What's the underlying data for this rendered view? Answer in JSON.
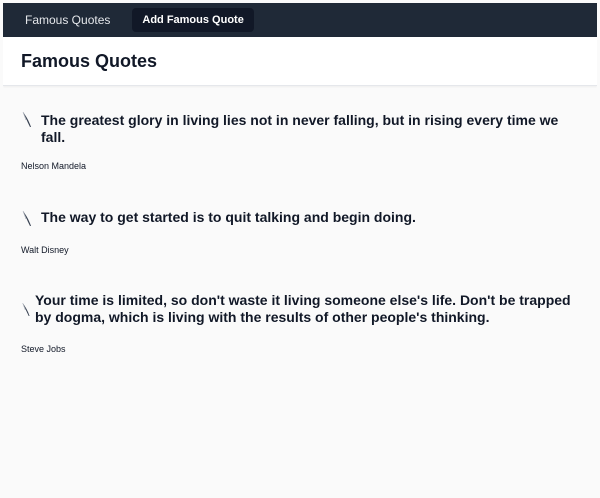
{
  "nav": {
    "brand_label": "Famous Quotes",
    "add_label": "Add Famous Quote"
  },
  "header": {
    "title": "Famous Quotes"
  },
  "quotes": [
    {
      "icon": "feather-quill-icon",
      "text": "The greatest glory in living lies not in never falling, but in rising every time we fall.",
      "author": "Nelson Mandela"
    },
    {
      "icon": "feather-quill-icon",
      "text": "The way to get started is to quit talking and begin doing.",
      "author": "Walt Disney"
    },
    {
      "icon": "feather-quill-icon",
      "text": "Your time is limited, so don't waste it living someone else's life. Don't be trapped by dogma, which is living with the results of other people's thinking.",
      "author": "Steve Jobs"
    }
  ],
  "colors": {
    "navbar_bg": "#1f2937",
    "active_button_bg": "#111827",
    "page_bg": "#fafafa",
    "text": "#111827"
  }
}
